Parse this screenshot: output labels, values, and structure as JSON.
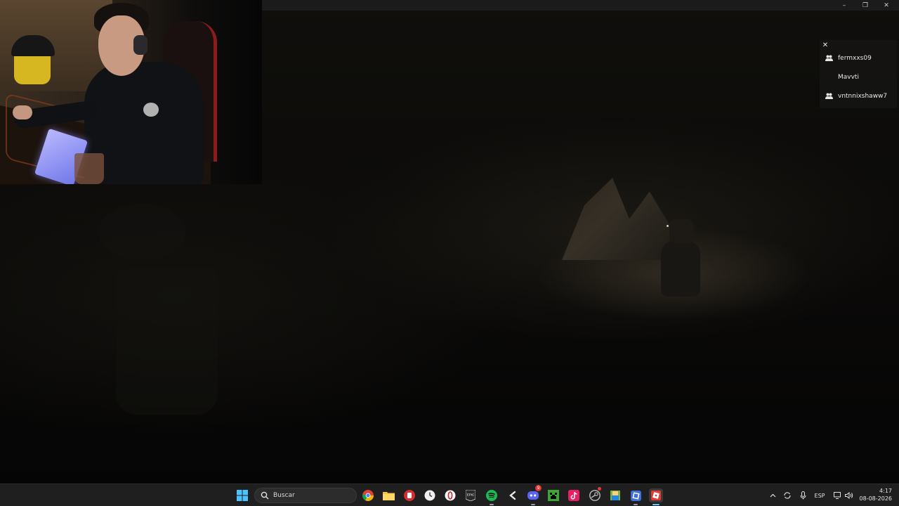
{
  "window": {
    "controls": [
      "–",
      "❐",
      "✕"
    ]
  },
  "player_list": {
    "close_label": "✕",
    "players": [
      {
        "name": "fermxxs09",
        "has_friend_icon": true
      },
      {
        "name": "Mavvti",
        "has_friend_icon": false
      },
      {
        "name": "vntnnixshaww7",
        "has_friend_icon": true
      }
    ]
  },
  "taskbar": {
    "search_placeholder": "Buscar",
    "pinned_apps": [
      "windows-start",
      "chrome",
      "file-explorer",
      "red-app",
      "clock-app",
      "opera-gx",
      "epic-games",
      "spotify",
      "g-app",
      "discord",
      "minecraft",
      "tiktok",
      "steam",
      "roblox-studio",
      "virtualbox",
      "roblox"
    ],
    "discord_badge": "9",
    "language": "ESP",
    "time": "4:17",
    "date": "08-08-2026"
  },
  "colors": {
    "taskbar_bg": "#1f1f1f",
    "spotify": "#1db954",
    "chrome": "#4285f4",
    "discord": "#5865f2"
  }
}
